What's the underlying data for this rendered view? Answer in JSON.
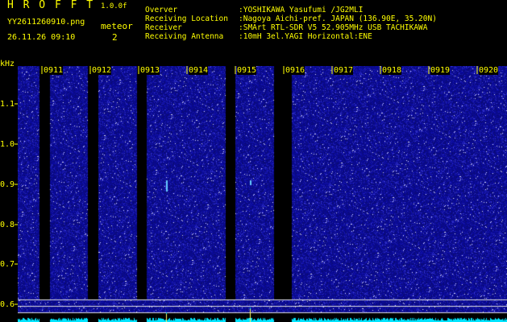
{
  "header": {
    "app_name": "H R O F F T",
    "version": "1.0.0f",
    "file_name": "YY2611260910.png",
    "datetime": "26.11.26 09:10",
    "meteor_label": "meteor",
    "meteor_count": "2"
  },
  "info": {
    "observer_label": "Overver",
    "observer_value": ":YOSHIKAWA Yasufumi /JG2MLI",
    "location_label": "Receiving Location",
    "location_value": ":Nagoya Aichi-pref. JAPAN (136.90E, 35.20N)",
    "receiver_label": "Receiver",
    "receiver_value": ":SMArt RTL-SDR V5 52.905MHz USB TACHIKAWA",
    "antenna_label": "Receiving Antenna",
    "antenna_value": ":10mH 3el.YAGI Horizontal:ENE"
  },
  "axis": {
    "unit": "kHz",
    "freq_ticks": [
      "1.1",
      "1.0",
      "0.9",
      "0.8",
      "0.7",
      "0.6"
    ],
    "time_ticks": [
      "0911",
      "0912",
      "0913",
      "0914",
      "0915",
      "0916",
      "0917",
      "0918",
      "0919",
      "0920"
    ]
  },
  "colors": {
    "text": "#ffff00",
    "background": "#000000",
    "noise": "#1a1aa8",
    "bright": "#ffffff",
    "spectrum_trace": "#00e5ff",
    "gap": "#000000",
    "reference_line": "#e0e0e0"
  }
}
